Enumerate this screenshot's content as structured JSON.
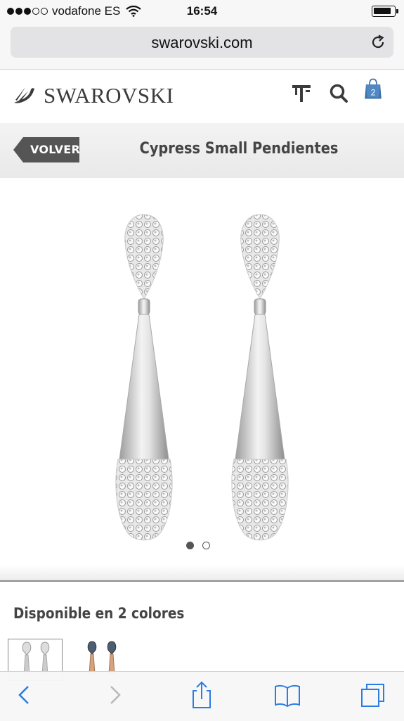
{
  "status_bar": {
    "carrier": "vodafone ES",
    "time": "16:54"
  },
  "browser": {
    "url": "swarovski.com"
  },
  "site": {
    "brand": "SWAROVSKI",
    "cart_count": "2"
  },
  "product_header": {
    "back_label": "VOLVER",
    "title": "Cypress Small Pendientes"
  },
  "carousel": {
    "current": 1,
    "total": 2
  },
  "colors": {
    "heading": "Disponible en 2 colores",
    "options": [
      "crystal-silver",
      "blue-rose-gold"
    ]
  },
  "theme": {
    "accent": "#3a6fa5",
    "back_bg": "#555555",
    "toolbar_blue": "#2b7de1"
  },
  "icons": [
    "wifi-icon",
    "battery-icon",
    "reload-icon",
    "store-icon",
    "search-icon",
    "shopping-bag-icon",
    "back-arrow-icon",
    "forward-arrow-icon",
    "share-icon",
    "bookmarks-icon",
    "tabs-icon"
  ]
}
